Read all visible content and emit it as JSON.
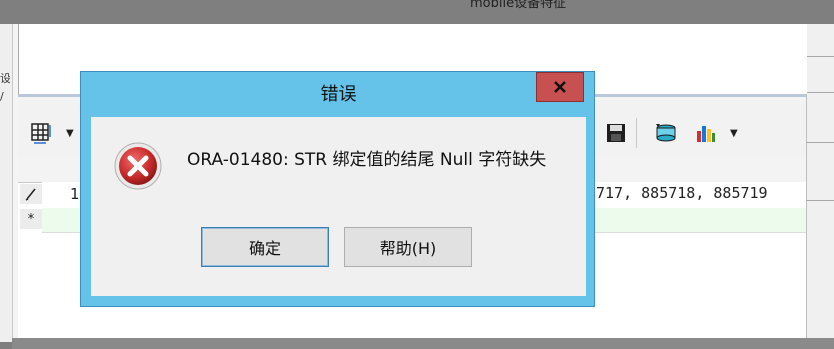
{
  "background_window": {
    "title_fragment": "mobile设备特征",
    "left_glyphs": [
      "设",
      "/"
    ],
    "grid": {
      "row_markers": [
        "pencil-icon",
        "*"
      ],
      "row_number": "1",
      "row1_text": "717, 885718, 885719"
    }
  },
  "dialog": {
    "title": "错误",
    "close_label": "x",
    "message": "ORA-01480: STR 绑定值的结尾 Null 字符缺失",
    "buttons": {
      "ok": "确定",
      "help": "帮助(H)"
    }
  },
  "colors": {
    "dialog_frame": "#65c3ea",
    "close_button": "#c75050",
    "error_icon": "#c62828",
    "new_row_highlight": "#ecfbec"
  }
}
